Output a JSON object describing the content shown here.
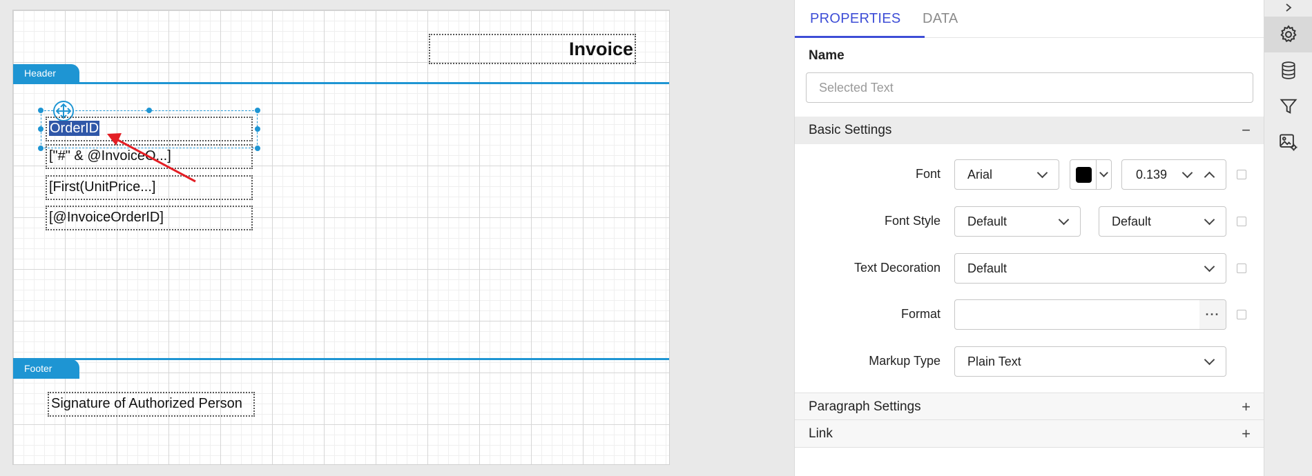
{
  "canvas": {
    "title_text": "Invoice",
    "header_band": "Header",
    "footer_band": "Footer",
    "selected_item_text": "OrderID",
    "items": [
      "[\"#\" & @InvoiceO...]",
      "[First(UnitPrice...]",
      "[@InvoiceOrderID]"
    ],
    "footer_item": "Signature of Authorized Person"
  },
  "panel": {
    "tabs": {
      "properties": "PROPERTIES",
      "data": "DATA"
    },
    "name": {
      "label": "Name",
      "placeholder": "Selected Text"
    },
    "basic_settings": {
      "title": "Basic Settings",
      "toggle": "−",
      "font": {
        "label": "Font",
        "family": "Arial",
        "color": "#000000",
        "size": "0.139"
      },
      "font_style": {
        "label": "Font Style",
        "style": "Default",
        "weight": "Default"
      },
      "text_decoration": {
        "label": "Text Decoration",
        "value": "Default"
      },
      "format": {
        "label": "Format",
        "value": "",
        "more": "···"
      },
      "markup_type": {
        "label": "Markup Type",
        "value": "Plain Text"
      }
    },
    "paragraph_settings": {
      "title": "Paragraph Settings",
      "toggle": "+"
    },
    "link": {
      "title": "Link",
      "toggle": "+"
    }
  },
  "colors": {
    "accent": "#3d4dd6",
    "band": "#1e95d3",
    "selection": "#2f57a8",
    "arrow": "#e31e24"
  },
  "toolbar": {
    "icons": [
      "chevron-right-icon",
      "gear-icon",
      "database-icon",
      "filter-icon",
      "image-settings-icon"
    ]
  }
}
